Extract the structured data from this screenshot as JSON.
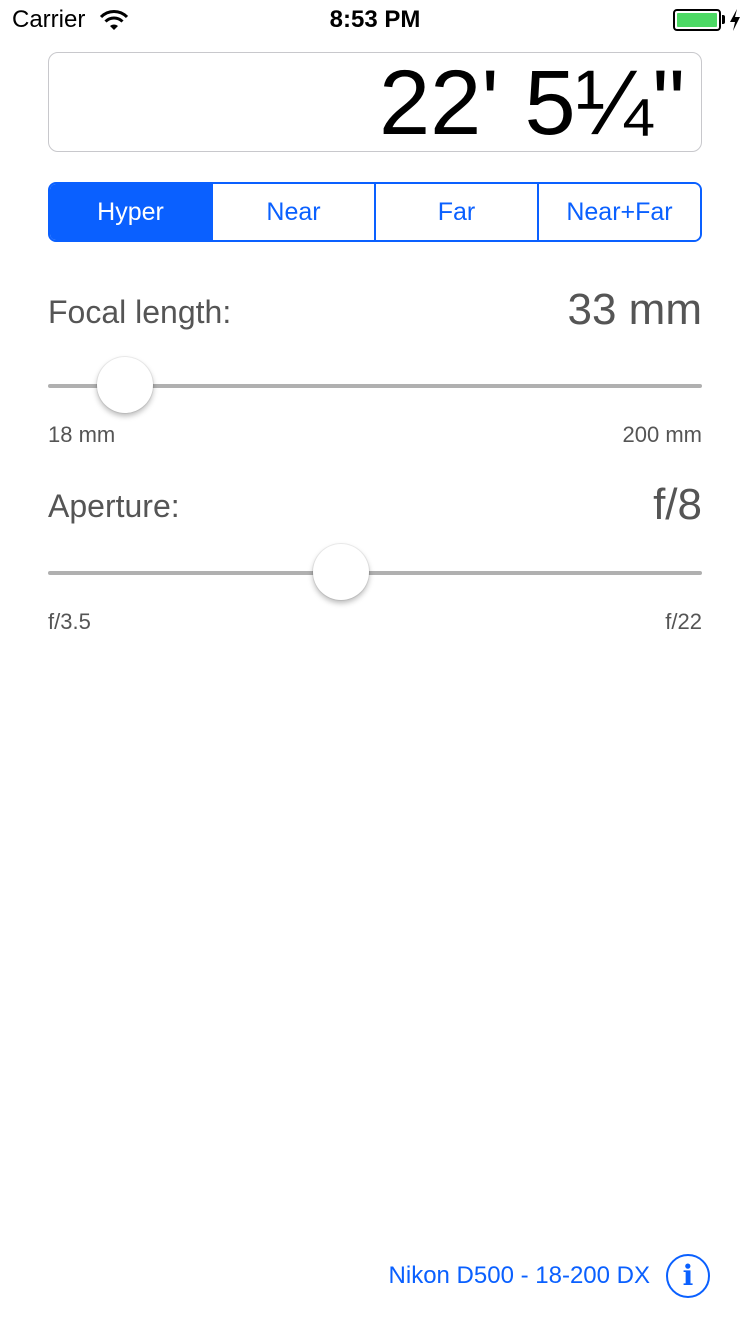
{
  "status_bar": {
    "carrier": "Carrier",
    "time": "8:53 PM",
    "battery_color": "#4cd964"
  },
  "result": {
    "value": "22' 5¼\""
  },
  "modes": {
    "items": [
      "Hyper",
      "Near",
      "Far",
      "Near+Far"
    ],
    "selected": "Hyper",
    "accent": "#0a60ff"
  },
  "focal_length": {
    "label": "Focal length:",
    "value": "33 mm",
    "min_label": "18 mm",
    "max_label": "200 mm",
    "position": 0.0824
  },
  "aperture": {
    "label": "Aperture:",
    "value": "f/8",
    "min_label": "f/3.5",
    "max_label": "f/22",
    "position": 0.4435
  },
  "footer": {
    "camera": "Nikon D500 - 18-200 DX",
    "info_icon": "info-icon"
  }
}
